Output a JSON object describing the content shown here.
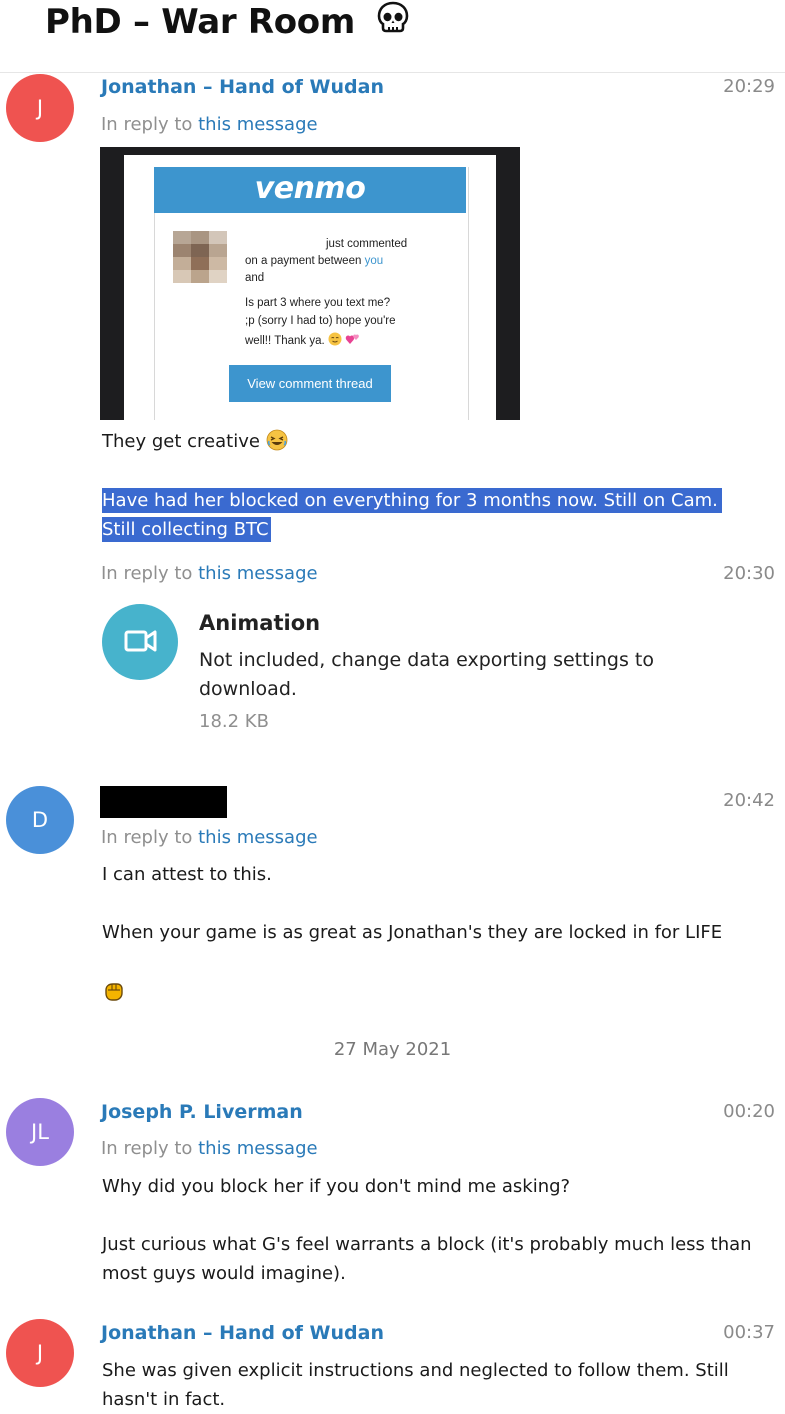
{
  "chat": {
    "title": "PhD – War Room",
    "title_icon": "skull-emoji"
  },
  "messages": [
    {
      "avatar_initials": "J",
      "avatar_color": "#ef5350",
      "sender": "Jonathan – Hand of Wudan",
      "time": "20:29",
      "reply_prefix": "In reply to",
      "reply_link": "this message",
      "venmo": {
        "logo": "venmo",
        "line1": "just commented",
        "line2_pre": "on a payment between ",
        "line2_link": "you",
        "line3": "and",
        "comment1": "Is part 3 where you text me?",
        "comment2": ";p (sorry I had to) hope you're",
        "comment3": "well!! Thank ya.",
        "button": "View comment thread"
      },
      "text1": "They get creative",
      "text2_line1": "Have had her blocked on everything for 3 months now. Still on Cam.",
      "text2_line2": "Still collecting BTC"
    },
    {
      "time": "20:30",
      "reply_prefix": "In reply to",
      "reply_link": "this message",
      "media_title": "Animation",
      "media_desc": "Not included, change data exporting settings to download.",
      "media_size": "18.2 KB"
    },
    {
      "avatar_initials": "D",
      "avatar_color": "#4a90d9",
      "sender_redacted": true,
      "time": "20:42",
      "reply_prefix": "In reply to",
      "reply_link": "this message",
      "text1": "I can attest to this.",
      "text2": "When your game is as great as Jonathan's they are locked in for LIFE"
    },
    {
      "date_separator": "27 May 2021"
    },
    {
      "avatar_initials": "JL",
      "avatar_color": "#9a7fe0",
      "sender": "Joseph P. Liverman",
      "time": "00:20",
      "reply_prefix": "In reply to",
      "reply_link": "this message",
      "text1": "Why did you block her if you don't mind me asking?",
      "text2_line1": "Just curious what G's feel warrants a block (it's probably much less than",
      "text2_line2": "most guys would imagine)."
    },
    {
      "avatar_initials": "J",
      "avatar_color": "#ef5350",
      "sender": "Jonathan – Hand of Wudan",
      "time": "00:37",
      "text_line1": "She was given explicit instructions and neglected to follow them. Still",
      "text_line2": "hasn't in fact."
    }
  ]
}
